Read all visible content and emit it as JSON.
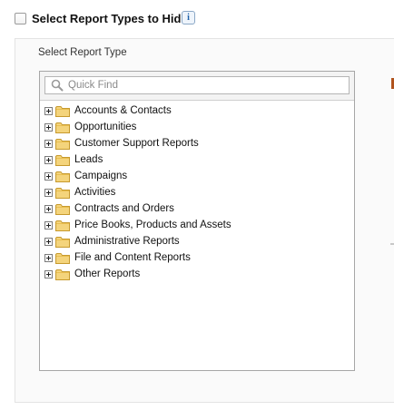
{
  "header": {
    "checkbox_label": "Select Report Types to Hide",
    "info_icon_glyph": "i"
  },
  "section": {
    "label": "Select Report Type"
  },
  "search": {
    "placeholder": "Quick Find",
    "value": ""
  },
  "tree": {
    "items": [
      {
        "label": "Accounts & Contacts",
        "icon": "folder-icon"
      },
      {
        "label": "Opportunities",
        "icon": "folder-icon"
      },
      {
        "label": "Customer Support Reports",
        "icon": "folder-icon"
      },
      {
        "label": "Leads",
        "icon": "folder-icon"
      },
      {
        "label": "Campaigns",
        "icon": "folder-icon"
      },
      {
        "label": "Activities",
        "icon": "folder-icon"
      },
      {
        "label": "Contracts and Orders",
        "icon": "folder-icon"
      },
      {
        "label": "Price Books, Products and Assets",
        "icon": "folder-icon"
      },
      {
        "label": "Administrative Reports",
        "icon": "folder-icon"
      },
      {
        "label": "File and Content Reports",
        "icon": "folder-icon"
      },
      {
        "label": "Other Reports",
        "icon": "folder-icon"
      }
    ]
  },
  "colors": {
    "folder_fill": "#f4d47c",
    "folder_stroke": "#c79a2e",
    "info_blue": "#1b5fa8"
  }
}
